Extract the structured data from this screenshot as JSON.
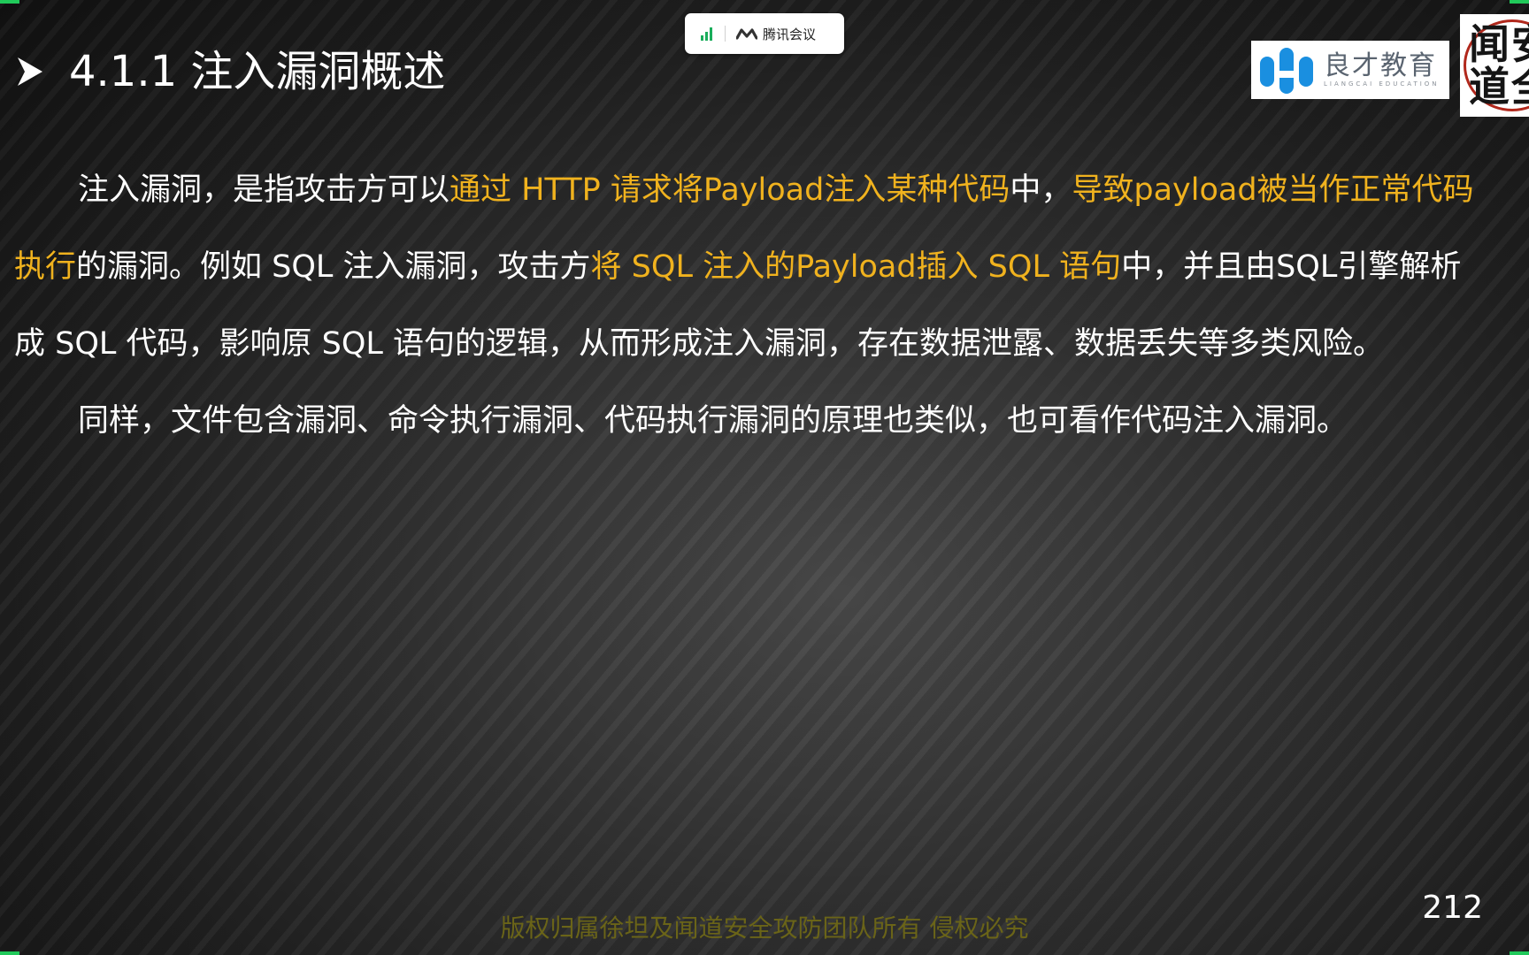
{
  "meeting_badge": {
    "app_name": "腾讯会议",
    "signal_color": "#1aad5b"
  },
  "slide": {
    "title": "4.1.1 注入漏洞概述",
    "title_bullet_icon": "arrowhead-bullet-icon",
    "paragraph1": {
      "t1": "注入漏洞，是指攻击方可以",
      "h1": "通过 HTTP 请求将Payload注入某种代码",
      "t2": "中，",
      "h2": "导致payload被当作正常代码执行",
      "t3": "的漏洞。例如 SQL 注入漏洞，攻击方",
      "h3": "将 SQL 注入的Payload插入 SQL 语句",
      "t4": "中，并且由SQL引擎解析成 SQL 代码，影响原 SQL 语句的逻辑，从而形成注入漏洞，存在数据泄露、数据丢失等多类风险。"
    },
    "paragraph2": "同样，文件包含漏洞、命令执行漏洞、代码执行漏洞的原理也类似，也可看作代码注入漏洞。",
    "copyright": "版权归属徐坦及闻道安全攻防团队所有    侵权必究",
    "page_number": "212"
  },
  "brand": {
    "name": "良才教育",
    "subtitle": "LIANGCAI EDUCATION",
    "mark_color": "#1a8fe0"
  },
  "seal": {
    "glyphs": "闻安道全"
  },
  "colors": {
    "highlight": "#f0b21e",
    "text": "#ffffff",
    "corner_marker": "#20c95a"
  }
}
